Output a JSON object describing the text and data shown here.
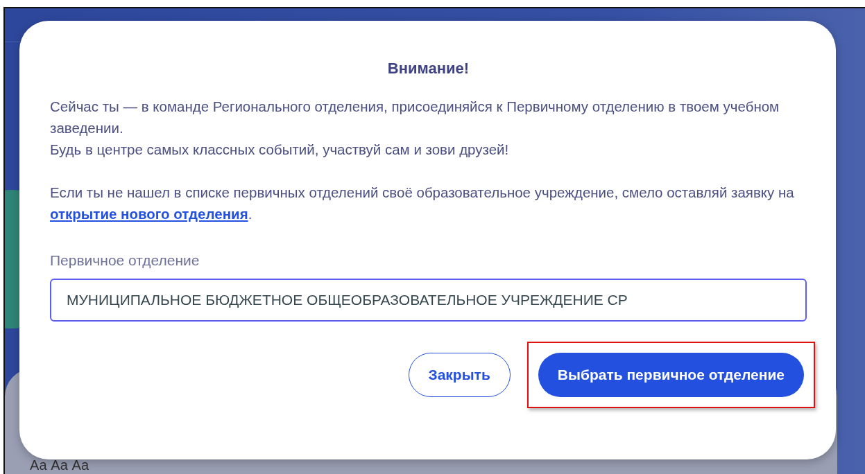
{
  "background": {
    "font_sample": "Аа Аа Аа"
  },
  "dialog": {
    "title": "Внимание!",
    "paragraphs": [
      {
        "lines": [
          "Сейчас ты — в команде Регионального отделения, присоединяйся к Первичному отделению в твоем учебном заведении.",
          "Будь в центре самых классных событий, участвуй сам и зови друзей!"
        ]
      },
      {
        "text_before": "Если ты не нашел в списке первичных отделений своё образовательное учреждение, смело оставляй заявку на ",
        "link": "открытие нового отделения",
        "text_after": "."
      }
    ],
    "field": {
      "label": "Первичное отделение",
      "value": "МУНИЦИПАЛЬНОЕ БЮДЖЕТНОЕ ОБЩЕОБРАЗОВАТЕЛЬНОЕ УЧРЕЖДЕНИЕ СР",
      "focused": true
    },
    "buttons": [
      {
        "label": "Закрыть",
        "kind": "secondary",
        "highlighted": false
      },
      {
        "label": "Выбрать первичное отделение",
        "kind": "primary",
        "highlighted": true
      }
    ]
  }
}
